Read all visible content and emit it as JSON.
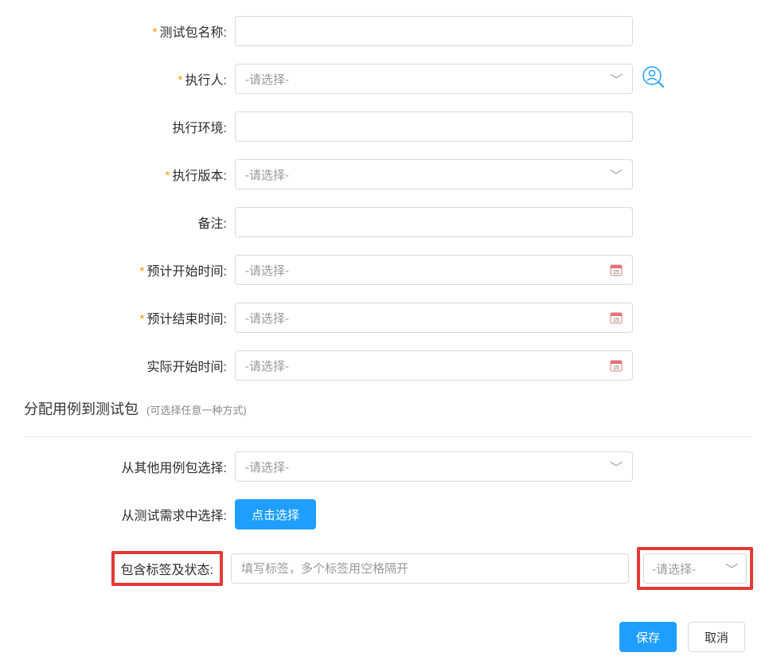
{
  "fields": {
    "package_name": {
      "label": "测试包名称",
      "value": ""
    },
    "executor": {
      "label": "执行人",
      "placeholder": "-请选择-"
    },
    "environment": {
      "label": "执行环境",
      "value": ""
    },
    "version": {
      "label": "执行版本",
      "placeholder": "-请选择-"
    },
    "remark": {
      "label": "备注",
      "value": ""
    },
    "start_time": {
      "label": "预计开始时间",
      "placeholder": "-请选择-"
    },
    "end_time": {
      "label": "预计结束时间",
      "placeholder": "-请选择-"
    },
    "actual_start": {
      "label": "实际开始时间",
      "placeholder": "-请选择-"
    }
  },
  "section": {
    "title": "分配用例到测试包",
    "subtitle": "(可选择任意一种方式)",
    "from_other": {
      "label": "从其他用例包选择",
      "placeholder": "-请选择-"
    },
    "from_req": {
      "label": "从测试需求中选择",
      "button": "点击选择"
    },
    "tag_status": {
      "label": "包含标签及状态",
      "tag_placeholder": "填写标签，多个标签用空格隔开",
      "status_placeholder": "-请选择-"
    }
  },
  "footer": {
    "save": "保存",
    "cancel": "取消"
  }
}
